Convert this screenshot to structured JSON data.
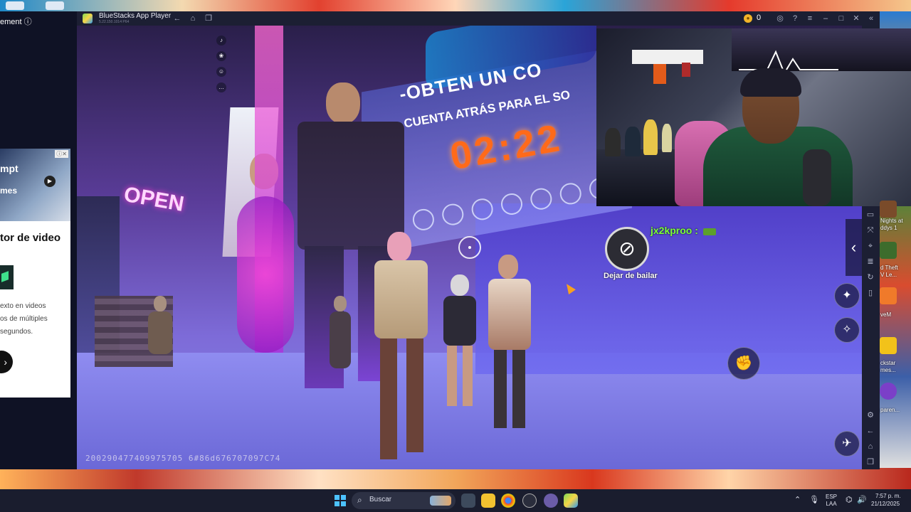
{
  "browser_panel": {
    "title_fragment": "ement ⓘ",
    "ad": {
      "badge": "ⓘ✕",
      "image_text_1": "mpt",
      "image_text_2": "mes",
      "heading": "tor de video",
      "desc_lines": [
        "exto en videos",
        "os de múltiples",
        "segundos."
      ],
      "cta_icon": "chevron-right-icon"
    }
  },
  "window": {
    "title": "BlueStacks App Player",
    "version": "5.22.150.1014 P64",
    "coins": "0",
    "accent_color": "#2e9bf0"
  },
  "game": {
    "sign_line_1": "-OBTEN UN CO",
    "sign_line_2": "CUENTA ATRÁS PARA EL SO",
    "countdown": "02:22",
    "open_sign": "OPEN",
    "emote_label": "Dejar de bailar",
    "player_name": "jx2kproo :",
    "session_id": "200290477409975705 6#86d676707097C74"
  },
  "taskbar": {
    "search_placeholder": "Buscar",
    "lang_line_1": "ESP",
    "lang_line_2": "LAA",
    "time": "7:57 p. m.",
    "date": "21/12/2025"
  },
  "desktop_icons": [
    {
      "label_1": "Nights at",
      "label_2": "ddys 1"
    },
    {
      "label_1": "d Theft",
      "label_2": "V Le..."
    },
    {
      "label_1": "veM",
      "label_2": ""
    },
    {
      "label_1": "ckstar",
      "label_2": "mes..."
    },
    {
      "label_1": "paren...",
      "label_2": ""
    }
  ]
}
